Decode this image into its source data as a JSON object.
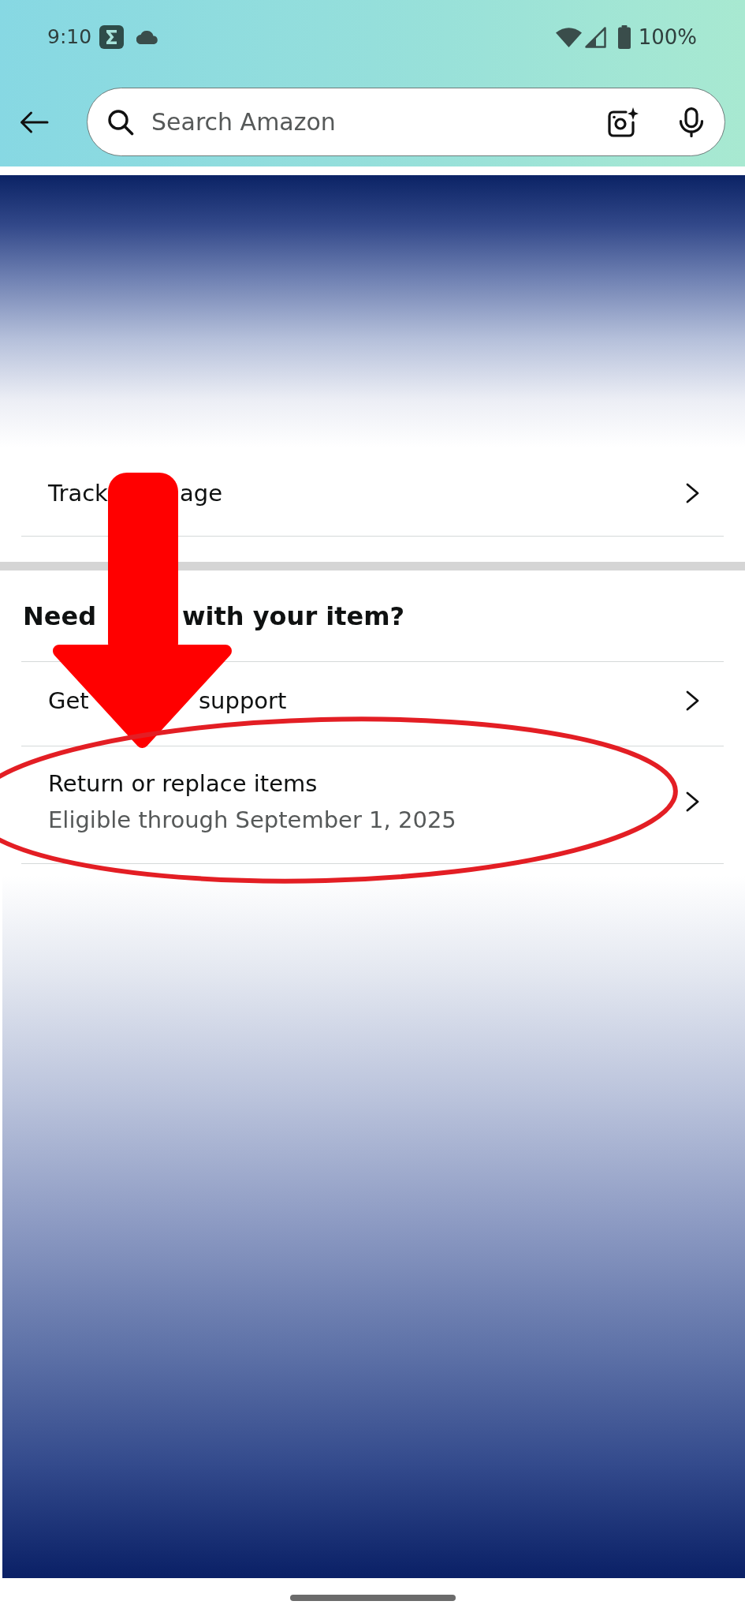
{
  "status_bar": {
    "time": "9:10",
    "battery": "100%"
  },
  "search": {
    "placeholder": "Search Amazon"
  },
  "tracking_rows": [
    {
      "title_parts": [
        "Track",
        "age"
      ]
    }
  ],
  "help_section": {
    "heading_parts": [
      "Need",
      "with your item?"
    ],
    "rows": [
      {
        "title_parts": [
          "Get",
          "support"
        ]
      },
      {
        "title_parts": [
          "Return or replace items"
        ],
        "subtitle": "Eligible through September 1, 2025"
      }
    ]
  }
}
